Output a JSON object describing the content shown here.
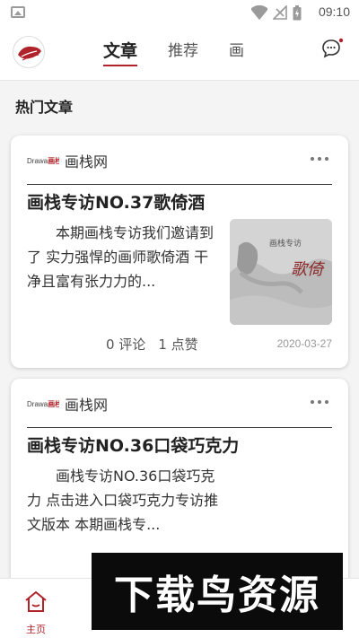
{
  "status_bar": {
    "time": "09:10"
  },
  "header": {
    "tabs": [
      {
        "label": "文章",
        "active": true
      },
      {
        "label": "推荐",
        "active": false
      },
      {
        "label": "画",
        "active": false
      }
    ],
    "accent_color": "#b0232a"
  },
  "section_title": "热门文章",
  "articles": [
    {
      "source_logo_a": "Drawa",
      "source_logo_b": "画栈",
      "source": "画栈网",
      "title": "画栈专访NO.37歌倚酒",
      "excerpt": "本期画栈专访我们邀请到了 实力强悍的画师歌倚酒 干净且富有张力力的...",
      "comments": "0 评论",
      "likes": "1 点赞",
      "date": "2020-03-27",
      "thumb_caption_small": "画栈专访",
      "thumb_caption_large": "歌倚"
    },
    {
      "source_logo_a": "Drawa",
      "source_logo_b": "画栈",
      "source": "画栈网",
      "title": "画栈专访NO.36口袋巧克力",
      "excerpt": "画栈专访NO.36口袋巧克力 点击进入口袋巧克力专访推文版本 本期画栈专..."
    }
  ],
  "bottom_nav": {
    "home_label": "主页"
  },
  "watermark": "下载鸟资源"
}
